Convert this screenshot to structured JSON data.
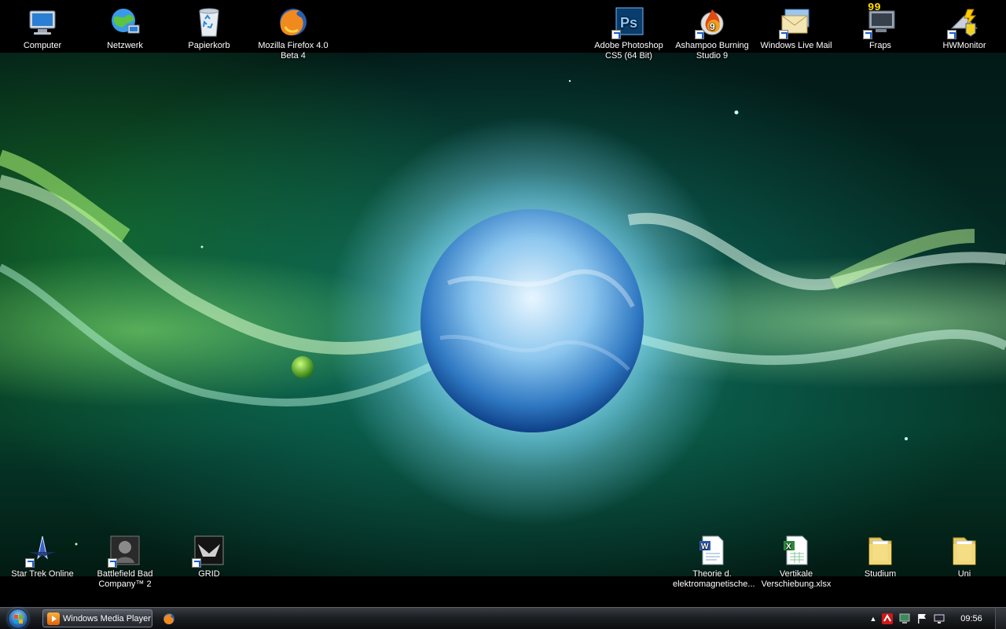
{
  "desktop": {
    "top_icons": [
      {
        "label": "Computer",
        "label2": ""
      },
      {
        "label": "Netzwerk",
        "label2": ""
      },
      {
        "label": "Papierkorb",
        "label2": ""
      },
      {
        "label": "Mozilla Firefox 4.0",
        "label2": "Beta 4"
      },
      {
        "label": "Adobe Photoshop",
        "label2": "CS5 (64 Bit)"
      },
      {
        "label": "Ashampoo Burning",
        "label2": "Studio 9"
      },
      {
        "label": "Windows Live Mail",
        "label2": ""
      },
      {
        "label": "Fraps",
        "label2": ""
      },
      {
        "label": "HWMonitor",
        "label2": ""
      }
    ],
    "bottom_icons": [
      {
        "label": "Star Trek Online",
        "label2": ""
      },
      {
        "label": "Battlefield Bad",
        "label2": "Company™ 2"
      },
      {
        "label": "GRID",
        "label2": ""
      },
      {
        "label": "Theorie d.",
        "label2": "elektromagnetische..."
      },
      {
        "label": "Vertikale",
        "label2": "Verschiebung.xlsx"
      },
      {
        "label": "Studium",
        "label2": ""
      },
      {
        "label": "Uni",
        "label2": ""
      }
    ],
    "fraps_badge": "99"
  },
  "taskbar": {
    "open_window": "Windows Media Player",
    "clock": "09:56",
    "tray_expand": "▲"
  },
  "colors": {
    "accent_blue": "#1a5fd0",
    "ps_blue": "#0a3d6b",
    "fraps_yellow": "#ffdd00"
  }
}
